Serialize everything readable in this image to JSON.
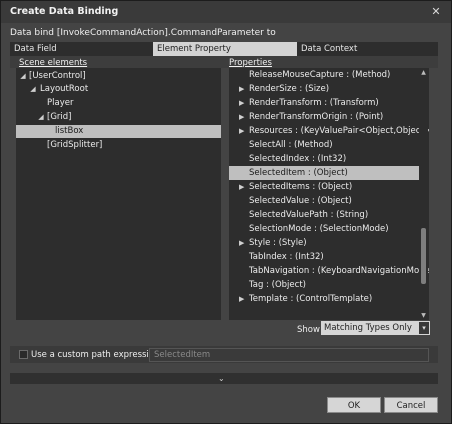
{
  "window": {
    "title": "Create Data Binding",
    "close_glyph": "✕"
  },
  "bind_target_label": "Data bind [InvokeCommandAction].CommandParameter to",
  "tabs": [
    {
      "label": "Data Field",
      "selected": false
    },
    {
      "label": "Element Property",
      "selected": true
    },
    {
      "label": "Data Context",
      "selected": false
    }
  ],
  "scene_elements": {
    "header": "Scene elements",
    "nodes": [
      {
        "label": "[UserControl]",
        "expanded": true,
        "level": 0,
        "selected": false
      },
      {
        "label": "LayoutRoot",
        "expanded": true,
        "level": 1,
        "selected": false
      },
      {
        "label": "Player",
        "expanded": null,
        "level": 2,
        "selected": false
      },
      {
        "label": "[Grid]",
        "expanded": true,
        "level": 2,
        "selected": false
      },
      {
        "label": "listBox",
        "expanded": null,
        "level": 3,
        "selected": true
      },
      {
        "label": "[GridSplitter]",
        "expanded": null,
        "level": 2,
        "selected": false
      }
    ]
  },
  "properties": {
    "header": "Properties",
    "items": [
      {
        "label": "ReleaseMouseCapture : (Method)",
        "expandable": false,
        "selected": false
      },
      {
        "label": "RenderSize : (Size)",
        "expandable": true,
        "selected": false
      },
      {
        "label": "RenderTransform : (Transform)",
        "expandable": true,
        "selected": false
      },
      {
        "label": "RenderTransformOrigin : (Point)",
        "expandable": true,
        "selected": false
      },
      {
        "label": "Resources : (KeyValuePair<Object,Object>)",
        "expandable": true,
        "selected": false
      },
      {
        "label": "SelectAll : (Method)",
        "expandable": false,
        "selected": false
      },
      {
        "label": "SelectedIndex : (Int32)",
        "expandable": false,
        "selected": false
      },
      {
        "label": "SelectedItem : (Object)",
        "expandable": false,
        "selected": true
      },
      {
        "label": "SelectedItems : (Object)",
        "expandable": true,
        "selected": false
      },
      {
        "label": "SelectedValue : (Object)",
        "expandable": false,
        "selected": false
      },
      {
        "label": "SelectedValuePath : (String)",
        "expandable": false,
        "selected": false
      },
      {
        "label": "SelectionMode : (SelectionMode)",
        "expandable": false,
        "selected": false
      },
      {
        "label": "Style : (Style)",
        "expandable": true,
        "selected": false
      },
      {
        "label": "TabIndex : (Int32)",
        "expandable": false,
        "selected": false
      },
      {
        "label": "TabNavigation : (KeyboardNavigationMode)",
        "expandable": false,
        "selected": false
      },
      {
        "label": "Tag : (Object)",
        "expandable": false,
        "selected": false
      },
      {
        "label": "Template : (ControlTemplate)",
        "expandable": true,
        "selected": false
      }
    ]
  },
  "show": {
    "label": "Show",
    "selected": "Matching Types Only"
  },
  "custom_path": {
    "label": "Use a custom path expression",
    "checked": false,
    "value": "SelectedItem"
  },
  "buttons": {
    "ok": "OK",
    "cancel": "Cancel"
  },
  "icons": {
    "expand": "triangle-right-icon",
    "collapse": "triangle-down-icon",
    "dropdown": "chevron-down-icon",
    "more_options": "double-chevron-down-icon"
  }
}
